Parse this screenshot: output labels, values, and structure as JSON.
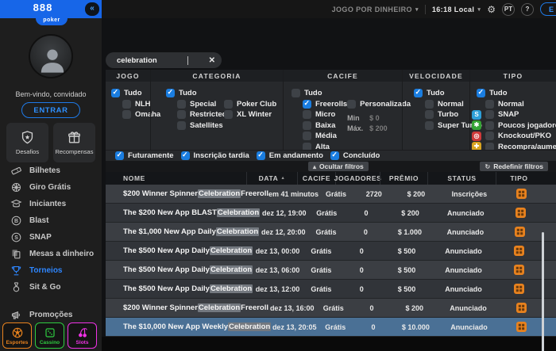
{
  "topbar": {
    "logo": {
      "brand": "888",
      "sub": "poker"
    },
    "collapse_icon": "«",
    "money_mode": "JOGO POR DINHEIRO",
    "time": "16:18 Local",
    "caret_icon": "▾",
    "gear_icon": "⚙",
    "lang": "PT",
    "help": "?",
    "login_partial": "E"
  },
  "sidebar": {
    "welcome": "Bem-vindo, convidado",
    "login_label": "ENTRAR",
    "tiles": [
      {
        "label": "Desafios"
      },
      {
        "label": "Recompensas"
      }
    ],
    "items": [
      {
        "label": "Bilhetes"
      },
      {
        "label": "Giro Grátis"
      },
      {
        "label": "Iniciantes"
      },
      {
        "label": "Blast"
      },
      {
        "label": "SNAP"
      },
      {
        "label": "Mesas a dinheiro"
      },
      {
        "label": "Torneios",
        "active": true
      },
      {
        "label": "Sit & Go"
      }
    ],
    "promotions_label": "Promoções",
    "bottom_buttons": [
      {
        "label": "Esportes",
        "color": "#e8821e"
      },
      {
        "label": "Cassino",
        "color": "#2ecc40"
      },
      {
        "label": "Slots",
        "color": "#f032e6"
      }
    ]
  },
  "search": {
    "value": "celebration",
    "clear_icon": "✕"
  },
  "filters": {
    "jogo": {
      "title": "JOGO",
      "options": [
        {
          "label": "Tudo",
          "checked": true
        },
        {
          "label": "NLH",
          "checked": false
        },
        {
          "label": "Omaha",
          "checked": false
        }
      ]
    },
    "categoria": {
      "title": "CATEGORIA",
      "col1": [
        {
          "label": "Tudo",
          "checked": true
        },
        {
          "label": "Special",
          "checked": false
        },
        {
          "label": "Restricted",
          "checked": false
        },
        {
          "label": "Satellites",
          "checked": false
        }
      ],
      "col2": [
        {
          "label": "Poker Club",
          "checked": false
        },
        {
          "label": "XL Winter",
          "checked": false
        }
      ]
    },
    "cacife": {
      "title": "CACIFE",
      "col1": [
        {
          "label": "Tudo",
          "checked": false
        },
        {
          "label": "Freerolls",
          "checked": true
        },
        {
          "label": "Micro",
          "checked": false
        },
        {
          "label": "Baixa",
          "checked": false
        },
        {
          "label": "Média",
          "checked": false
        },
        {
          "label": "Alta",
          "checked": false
        }
      ],
      "custom": {
        "label": "Personalizada",
        "checked": false,
        "min_label": "Min",
        "min_value": "$ 0",
        "max_label": "Máx.",
        "max_value": "$ 200"
      }
    },
    "velocidade": {
      "title": "VELOCIDADE",
      "options": [
        {
          "label": "Tudo",
          "checked": true
        },
        {
          "label": "Normal",
          "checked": false
        },
        {
          "label": "Turbo",
          "checked": false
        },
        {
          "label": "Super Turbo",
          "checked": false
        }
      ]
    },
    "tipo": {
      "title": "TIPO",
      "options": [
        {
          "label": "Tudo",
          "checked": true
        },
        {
          "label": "Normal",
          "checked": false
        },
        {
          "label": "SNAP",
          "checked": false,
          "icon": "S",
          "icon_color": "#2d9fd8"
        },
        {
          "label": "Poucos jogadores",
          "checked": false,
          "icon": "✱",
          "icon_color": "#35a435"
        },
        {
          "label": "Knockout/PKO",
          "checked": false,
          "icon": "◎",
          "icon_color": "#cf3a3a"
        },
        {
          "label": "Recompra/aumento",
          "checked": false,
          "icon": "✚",
          "icon_color": "#d9a421"
        }
      ]
    },
    "status_row": [
      {
        "label": "Futuramente",
        "checked": true
      },
      {
        "label": "Inscrição tardia",
        "checked": true
      },
      {
        "label": "Em andamento",
        "checked": true
      },
      {
        "label": "Concluído",
        "checked": true
      }
    ],
    "hide_label": "Ocultar filtros",
    "hide_icon": "▴",
    "reset_label": "Redefinir filtros",
    "reset_icon": "↻"
  },
  "table": {
    "columns": [
      "NOME",
      "DATA",
      "CACIFE",
      "JOGADORES",
      "PRÊMIO",
      "STATUS",
      "TIPO"
    ],
    "sort_icon": "▲",
    "type_icon_color": "#e8821e",
    "rows": [
      {
        "pre": "$200 Winner Spinner ",
        "hl": "Celebration",
        "post": " Freeroll",
        "date": "em 41 minutos",
        "cacife": "Grátis",
        "players": "2720",
        "prize": "$ 200",
        "status": "Inscrições",
        "selected": false
      },
      {
        "pre": "The $200 New App BLAST ",
        "hl": "Celebration",
        "post": "",
        "date": "dez 12, 19:00",
        "cacife": "Grátis",
        "players": "0",
        "prize": "$ 200",
        "status": "Anunciado",
        "selected": false
      },
      {
        "pre": "The $1,000 New App Daily ",
        "hl": "Celebration",
        "post": "",
        "date": "dez 12, 20:00",
        "cacife": "Grátis",
        "players": "0",
        "prize": "$ 1.000",
        "status": "Anunciado",
        "selected": false
      },
      {
        "pre": "The $500 New App Daily ",
        "hl": "Celebration",
        "post": "",
        "date": "dez 13, 00:00",
        "cacife": "Grátis",
        "players": "0",
        "prize": "$ 500",
        "status": "Anunciado",
        "selected": false
      },
      {
        "pre": "The $500 New App Daily ",
        "hl": "Celebration",
        "post": "",
        "date": "dez 13, 06:00",
        "cacife": "Grátis",
        "players": "0",
        "prize": "$ 500",
        "status": "Anunciado",
        "selected": false
      },
      {
        "pre": "The $500 New App Daily ",
        "hl": "Celebration",
        "post": "",
        "date": "dez 13, 12:00",
        "cacife": "Grátis",
        "players": "0",
        "prize": "$ 500",
        "status": "Anunciado",
        "selected": false
      },
      {
        "pre": "$200 Winner Spinner ",
        "hl": "Celebration",
        "post": " Freeroll",
        "date": "dez 13, 16:00",
        "cacife": "Grátis",
        "players": "0",
        "prize": "$ 200",
        "status": "Anunciado",
        "selected": false
      },
      {
        "pre": "The $10,000 New App Weekly ",
        "hl": "Celebration",
        "post": "",
        "date": "dez 13, 20:05",
        "cacife": "Grátis",
        "players": "0",
        "prize": "$ 10.000",
        "status": "Anunciado",
        "selected": true
      }
    ]
  }
}
